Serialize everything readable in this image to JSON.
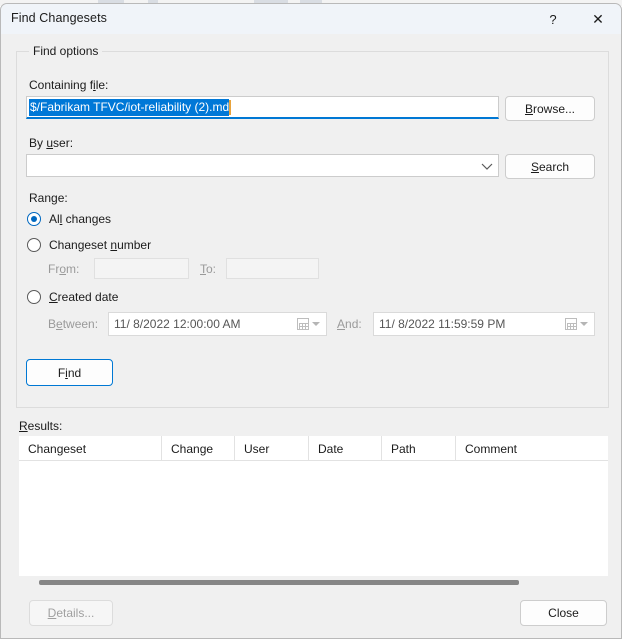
{
  "window": {
    "title": "Find Changesets",
    "help_icon": "question-mark-icon",
    "close_icon": "close-x-icon"
  },
  "find_options": {
    "legend": "Find options",
    "containing_file": {
      "label": "Containing file:",
      "label_prefix": "Containing f",
      "label_accel": "i",
      "label_suffix": "le:",
      "value": "$/Fabrikam TFVC/iot-reliability (2).md",
      "selected": true,
      "browse_button": "Browse...",
      "browse_prefix": "",
      "browse_accel": "B",
      "browse_suffix": "rowse..."
    },
    "by_user": {
      "label": "By user:",
      "label_prefix": "By ",
      "label_accel": "u",
      "label_suffix": "ser:",
      "value": "",
      "placeholder": "",
      "chevron_icon": "chevron-down-icon",
      "search_button": "Search",
      "search_accel": "S",
      "search_suffix": "earch"
    },
    "range": {
      "label": "Range:",
      "selected": "all_changes",
      "options": [
        {
          "id": "all_changes",
          "label": "All changes",
          "prefix": "Al",
          "accel": "l",
          "suffix": " changes",
          "checked": true
        },
        {
          "id": "changeset_number",
          "label": "Changeset number",
          "prefix": "Changeset ",
          "accel": "n",
          "suffix": "umber",
          "checked": false
        },
        {
          "id": "created_date",
          "label": "Created date",
          "prefix": "",
          "accel": "C",
          "suffix": "reated date",
          "checked": false
        }
      ],
      "changeset_number": {
        "from_label": "From:",
        "from_prefix": "Fr",
        "from_accel": "o",
        "from_suffix": "m:",
        "from_value": "",
        "to_label": "To:",
        "to_accel": "T",
        "to_suffix": "o:",
        "to_value": "",
        "enabled": false
      },
      "created_date": {
        "between_label": "Between:",
        "between_prefix": "B",
        "between_accel": "e",
        "between_suffix": "tween:",
        "between_value": "11/  8/2022 12:00:00 AM",
        "and_label": "And:",
        "and_prefix": "",
        "and_accel": "A",
        "and_suffix": "nd:",
        "and_value": "11/  8/2022 11:59:59 PM",
        "calendar_icon": "calendar-icon",
        "dropdown_icon": "dropdown-arrow-icon",
        "enabled": false
      }
    },
    "find_button": {
      "label": "Find",
      "prefix": "F",
      "accel": "i",
      "suffix": "nd",
      "is_default": true
    }
  },
  "results": {
    "label": "Results:",
    "label_accel": "R",
    "label_suffix": "esults:",
    "columns": [
      "Changeset",
      "Change",
      "User",
      "Date",
      "Path",
      "Comment"
    ],
    "rows": [],
    "scrollbar": "horizontal-scrollbar"
  },
  "footer": {
    "details_button": "Details...",
    "details_accel": "D",
    "details_suffix": "etails...",
    "details_enabled": false,
    "close_button": "Close",
    "close_enabled": true
  },
  "colors": {
    "accent": "#0078d4",
    "selection": "#0078d7",
    "radio_checked": "#0068c0",
    "caret": "#e8a33d",
    "window_bg": "#f0f0f0",
    "titlebar_bg": "#f0f4f9",
    "disabled_text": "#9a9a9a"
  }
}
